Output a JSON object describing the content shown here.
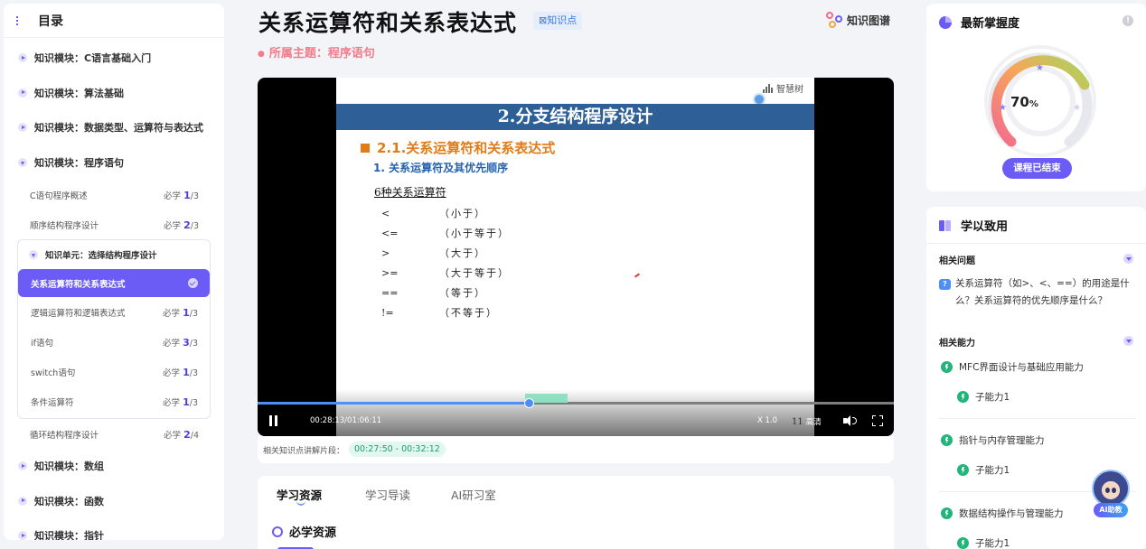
{
  "sidebar": {
    "title": "目录",
    "modules_top": [
      {
        "label": "知识模块：C语言基础入门"
      },
      {
        "label": "知识模块：算法基础"
      },
      {
        "label": "知识模块：数据类型、运算符与表达式"
      }
    ],
    "open_module": {
      "label": "知识模块：程序语句"
    },
    "lessons_before": [
      {
        "label": "C语句程序概述",
        "req": "必学",
        "done": "1",
        "total": "/3"
      },
      {
        "label": "顺序结构程序设计",
        "req": "必学",
        "done": "2",
        "total": "/3"
      }
    ],
    "unit": {
      "label": "知识单元：选择结构程序设计",
      "active_lesson": "关系运算符和关系表达式",
      "lessons": [
        {
          "label": "逻辑运算符和逻辑表达式",
          "req": "必学",
          "done": "1",
          "total": "/3"
        },
        {
          "label": "if语句",
          "req": "必学",
          "done": "3",
          "total": "/3"
        },
        {
          "label": "switch语句",
          "req": "必学",
          "done": "1",
          "total": "/3"
        },
        {
          "label": "条件运算符",
          "req": "必学",
          "done": "1",
          "total": "/3"
        }
      ]
    },
    "lesson_after": {
      "label": "循环结构程序设计",
      "req": "必学",
      "done": "2",
      "total": "/4"
    },
    "modules_bottom": [
      {
        "label": "知识模块：数组"
      },
      {
        "label": "知识模块：函数"
      },
      {
        "label": "知识模块：指针"
      }
    ]
  },
  "header": {
    "title": "关系运算符和关系表达式",
    "tag": "⊠知识点",
    "graph_label": "知识图谱",
    "topic": "所属主题：程序语句"
  },
  "video": {
    "logo": "智慧树",
    "slide_band": "2.分支结构程序设计",
    "section": "2.1.关系运算符和关系表达式",
    "subsection": "1. 关系运算符及其优先顺序",
    "ops_title": "6种关系运算符",
    "ops": [
      {
        "sym": "<",
        "desc": "（小于）"
      },
      {
        "sym": "<=",
        "desc": "（小于等于）"
      },
      {
        "sym": ">",
        "desc": "（大于）"
      },
      {
        "sym": ">=",
        "desc": "（大于等于）"
      },
      {
        "sym": "==",
        "desc": "（等于）"
      },
      {
        "sym": "!=",
        "desc": "（不等于）"
      }
    ],
    "progress": 0.426,
    "time": "00:28:13/01:06:11",
    "speed": "X 1.0",
    "quality": "高清",
    "quality_prefix": "11",
    "related_label": "相关知识点讲解片段：",
    "related_time": "00:27:50 - 00:32:12"
  },
  "resources": {
    "tabs": [
      "学习资源",
      "学习导读",
      "AI研习室"
    ],
    "must_learn": "必学资源"
  },
  "mastery": {
    "title": "最新掌握度",
    "value": "70",
    "unit": "%",
    "status": "课程已结束"
  },
  "apply": {
    "title": "学以致用",
    "related_q_label": "相关问题",
    "question": "关系运算符（如>、<、==）的用途是什么？关系运算符的优先顺序是什么？",
    "related_ab_label": "相关能力",
    "abilities": [
      {
        "label": "MFC界面设计与基础应用能力",
        "sub": "子能力1"
      },
      {
        "label": "指针与内存管理能力",
        "sub": "子能力1"
      },
      {
        "label": "数据结构操作与管理能力",
        "sub": "子能力1"
      }
    ]
  },
  "ai_helper": {
    "label": "AI助教"
  },
  "colors": {
    "accent": "#6b5cf6",
    "success": "#22b47a",
    "topic": "#f27c8a",
    "progress": "#4d8ef7"
  }
}
